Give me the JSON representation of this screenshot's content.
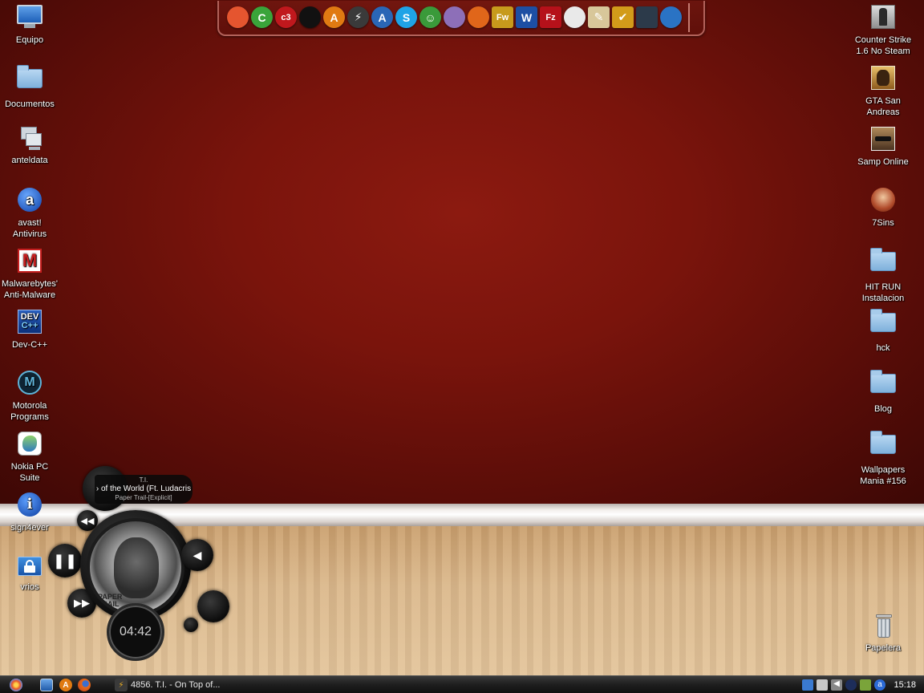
{
  "desktop_left": [
    {
      "label": "Equipo",
      "icon": "computer-icon"
    },
    {
      "label": "Documentos",
      "icon": "documents-folder-icon"
    },
    {
      "label": "anteldata",
      "icon": "network-computer-icon"
    },
    {
      "label": "avast!\nAntivirus",
      "icon": "avast-icon"
    },
    {
      "label": "Malwarebytes'\nAnti-Malware",
      "icon": "malwarebytes-icon"
    },
    {
      "label": "Dev-C++",
      "icon": "devcpp-icon"
    },
    {
      "label": "Motorola\nPrograms",
      "icon": "motorola-icon"
    },
    {
      "label": "Nokia PC Suite",
      "icon": "nokia-pc-suite-icon"
    },
    {
      "label": "sign4ever",
      "icon": "info-icon"
    },
    {
      "label": "vrios",
      "icon": "lock-icon"
    }
  ],
  "desktop_right": [
    {
      "label": "Counter Strike\n1.6 No Steam",
      "icon": "counter-strike-icon"
    },
    {
      "label": "GTA San\nAndreas",
      "icon": "gta-icon"
    },
    {
      "label": "Samp Online",
      "icon": "samp-icon"
    },
    {
      "label": "7Sins",
      "icon": "7sins-icon"
    },
    {
      "label": "HIT RUN\nInstalacion",
      "icon": "folder-icon"
    },
    {
      "label": "hck",
      "icon": "folder-icon"
    },
    {
      "label": "Blog",
      "icon": "folder-icon"
    },
    {
      "label": "Wallpapers\nMania #156",
      "icon": "folder-icon"
    },
    {
      "label": "Papelera",
      "icon": "recycle-bin-icon"
    }
  ],
  "dock": {
    "items": [
      {
        "icon": "media-player-icon",
        "glyph": "",
        "color": "#e5552f"
      },
      {
        "icon": "utorrent-icon",
        "glyph": "C",
        "color": "#3aa43a"
      },
      {
        "icon": "c3-icon",
        "glyph": "c3",
        "color": "#c0181d"
      },
      {
        "icon": "launcher-icon",
        "glyph": "",
        "color": "#111111"
      },
      {
        "icon": "aimp-icon",
        "glyph": "A",
        "color": "#e07a12"
      },
      {
        "icon": "winamp-icon",
        "glyph": "⚡",
        "color": "#3a3a3a"
      },
      {
        "icon": "avant-icon",
        "glyph": "A",
        "color": "#2a66b6"
      },
      {
        "icon": "skype-icon",
        "glyph": "S",
        "color": "#1fa3e6"
      },
      {
        "icon": "messenger-icon",
        "glyph": "☺",
        "color": "#3a9a3a"
      },
      {
        "icon": "pidgin-icon",
        "glyph": "",
        "color": "#8d6fb8"
      },
      {
        "icon": "firefox-icon",
        "glyph": "",
        "color": "#e0661a"
      },
      {
        "icon": "fireworks-icon",
        "glyph": "Fw",
        "color": "#c79a1c"
      },
      {
        "icon": "word-icon",
        "glyph": "W",
        "color": "#1d4fa3"
      },
      {
        "icon": "filezilla-icon",
        "glyph": "Fz",
        "color": "#b5111a"
      },
      {
        "icon": "picasa-icon",
        "glyph": "",
        "color": "#e9e9e9"
      },
      {
        "icon": "pencil-icon",
        "glyph": "✎",
        "color": "#d8c79a"
      },
      {
        "icon": "winrar-icon",
        "glyph": "✔",
        "color": "#d29b1a"
      },
      {
        "icon": "webcam-icon",
        "glyph": "",
        "color": "#2c3a4a"
      },
      {
        "icon": "drive-icon",
        "glyph": "",
        "color": "#2a73c4"
      }
    ]
  },
  "player": {
    "artist": "T.I.",
    "title": "› of the World (Ft. Ludacris",
    "album": "Paper Trail-[Explicit]",
    "time": "04:42",
    "cover_text": "PAPER\nTRAIL",
    "status": "playing"
  },
  "taskbar": {
    "task_label": "4856. T.I. - On Top of...",
    "clock": "15:18"
  }
}
